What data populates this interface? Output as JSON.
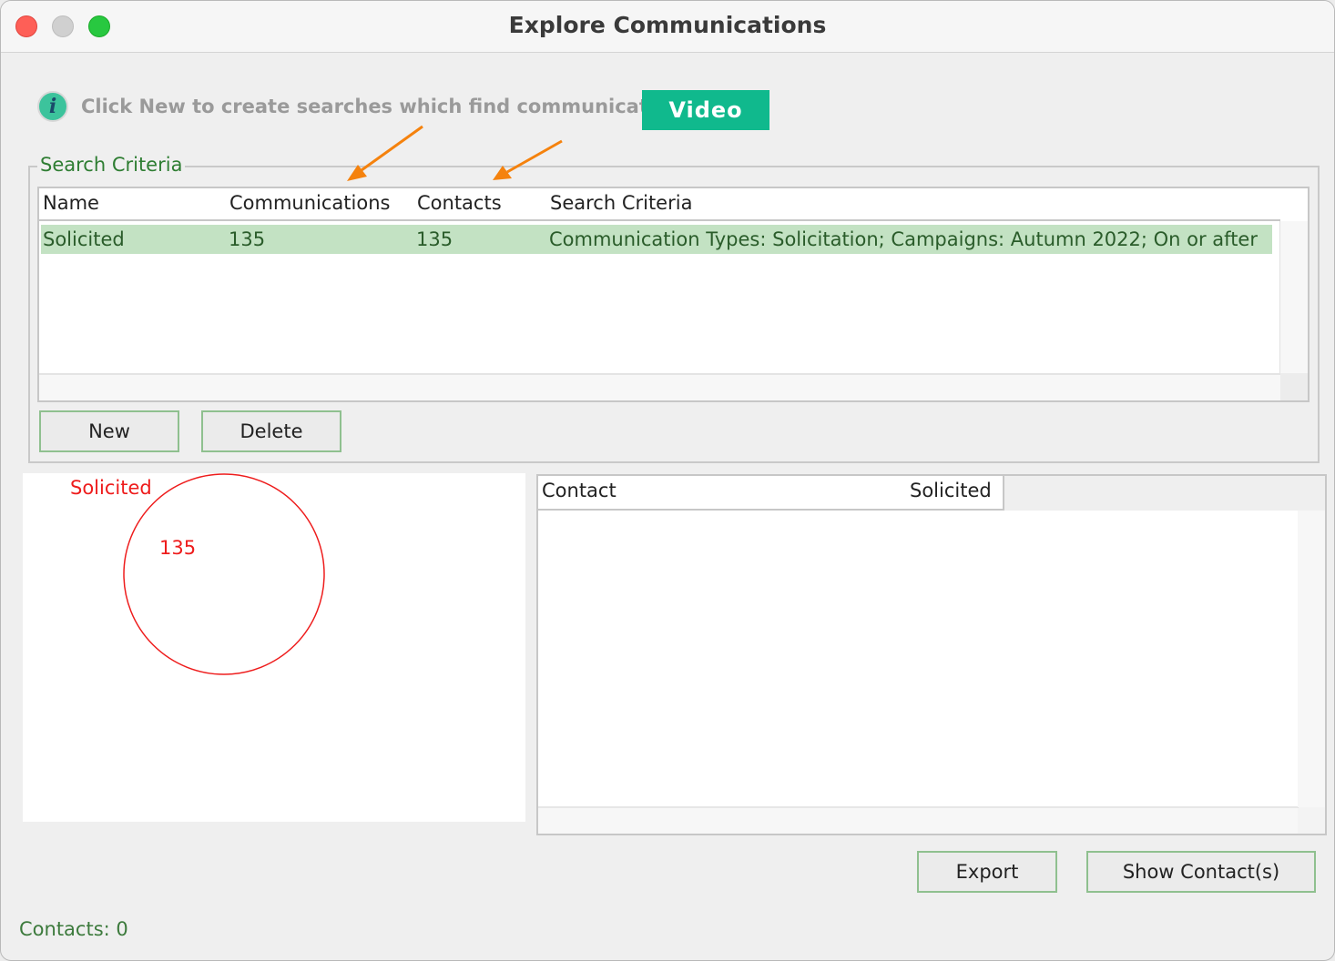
{
  "window": {
    "title": "Explore Communications"
  },
  "info": {
    "text": "Click New to create searches which find communications.",
    "video_label": "Video"
  },
  "search_criteria": {
    "legend": "Search Criteria",
    "columns": [
      "Name",
      "Communications",
      "Contacts",
      "Search Criteria"
    ],
    "rows": [
      {
        "name": "Solicited",
        "communications": "135",
        "contacts": "135",
        "criteria": "Communication Types: Solicitation; Campaigns: Autumn 2022; On or after"
      }
    ],
    "new_label": "New",
    "delete_label": "Delete"
  },
  "venn": {
    "label": "Solicited",
    "value": "135",
    "color": "#ee1c1c"
  },
  "contacts_table": {
    "columns": [
      "Contact",
      "Solicited"
    ]
  },
  "actions": {
    "export_label": "Export",
    "show_contacts_label": "Show Contact(s)"
  },
  "status": {
    "contacts": "Contacts: 0"
  },
  "colors": {
    "accent": "#10b98d",
    "selection": "#c3e2c3",
    "annotation_arrow": "#f5820d",
    "label_green": "#2e7d32"
  }
}
